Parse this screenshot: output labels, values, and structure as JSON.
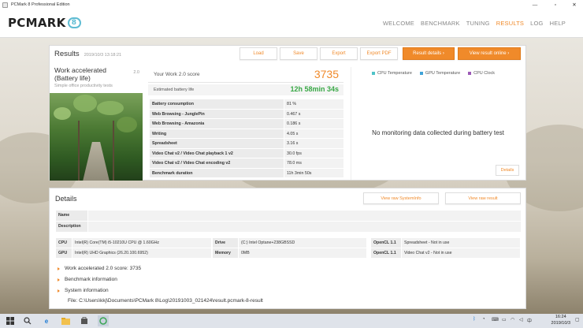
{
  "window": {
    "title": "PCMark 8 Professional Edition"
  },
  "logo": {
    "text": "PCMARK",
    "version": "8"
  },
  "nav": [
    "WELCOME",
    "BENCHMARK",
    "TUNING",
    "RESULTS",
    "LOG",
    "HELP"
  ],
  "results": {
    "title": "Results",
    "date": "2019/10/3 13:18:21",
    "buttons": {
      "load": "Load",
      "save": "Save",
      "export": "Export",
      "export_pdf": "Export PDF",
      "details": "Result details ›",
      "online": "View result online ›"
    },
    "test": {
      "name": "Work accelerated (Battery life)",
      "version": "2.0",
      "subtitle": "Simple office productivity tests"
    },
    "score_label": "Your Work 2.0 score",
    "score": "3735",
    "battery_label": "Estimated battery life",
    "battery_value": "12h 58min 34s",
    "metrics": [
      {
        "name": "Battery consumption",
        "value": "81 %"
      },
      {
        "name": "Web Browsing - JunglePin",
        "value": "0.467 s"
      },
      {
        "name": "Web Browsing - Amazonia",
        "value": "0.186 s"
      },
      {
        "name": "Writing",
        "value": "4.05 s"
      },
      {
        "name": "Spreadsheet",
        "value": "3.16 s"
      },
      {
        "name": "Video Chat v2 / Video Chat playback 1 v2",
        "value": "30.0 fps"
      },
      {
        "name": "Video Chat v2 / Video Chat encoding v2",
        "value": "78.0 ms"
      },
      {
        "name": "Benchmark duration",
        "value": "11h 3min 50s"
      }
    ],
    "monitor": {
      "legend": [
        {
          "label": "CPU Temperature",
          "color": "#4fc3c8"
        },
        {
          "label": "GPU Temperature",
          "color": "#3fa3d8"
        },
        {
          "label": "CPU Clock",
          "color": "#9b59b6"
        }
      ],
      "message": "No monitoring data collected during battery test",
      "details_btn": "Details"
    }
  },
  "details": {
    "title": "Details",
    "btn_systeminfo": "View raw SystemInfo",
    "btn_result": "View raw result",
    "name_label": "Name",
    "name_value": "",
    "desc_label": "Description",
    "desc_value": "",
    "cpu_label": "CPU",
    "cpu_value": "Intel(R) Core(TM) i5-10210U CPU @ 1.60GHz",
    "gpu_label": "GPU",
    "gpu_value": "Intel(R) UHD Graphics (26.20.100.6952)",
    "drive_label": "Drive",
    "drive_value": "(C:) Intel Optane+238GBSSD",
    "memory_label": "Memory",
    "memory_value": "0MB",
    "opencl1_label": "OpenCL 1.1",
    "opencl1_value": "Spreadsheet - Not in use",
    "opencl2_label": "OpenCL 1.1",
    "opencl2_value": "Video Chat v2 - Not in use",
    "expanders": [
      "Work accelerated 2.0 score: 3735",
      "Benchmark information",
      "System information"
    ],
    "file": "File: C:\\Users\\kkj\\Documents\\PCMark 8\\Log\\20191003_021424\\result.pcmark-8-result"
  },
  "taskbar": {
    "time": "16:24",
    "date": "2019/10/3",
    "ime": "中"
  }
}
